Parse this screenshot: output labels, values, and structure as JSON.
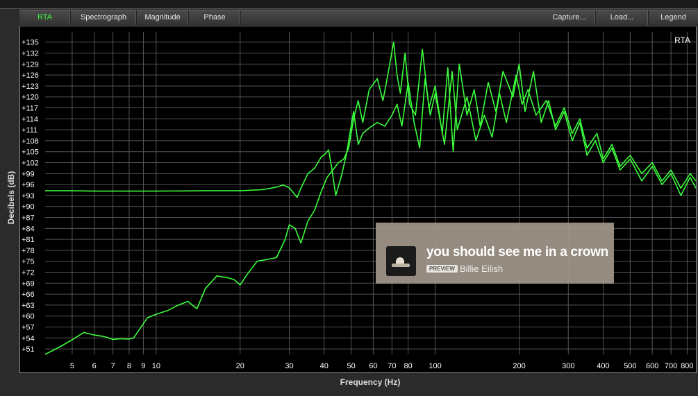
{
  "tabs": {
    "left": [
      "RTA",
      "Spectrograph",
      "Magnitude",
      "Phase"
    ],
    "right": [
      "Capture...",
      "Load...",
      "Legend"
    ],
    "active": "RTA"
  },
  "plot": {
    "title": "RTA",
    "ylabel": "Decibels (dB)",
    "xlabel": "Frequency (Hz)"
  },
  "now_playing": {
    "song": "you should see me in a crown",
    "badge": "PREVIEW",
    "artist": "Billie Eilish"
  },
  "chart_data": {
    "type": "line",
    "title": "RTA",
    "xlabel": "Frequency (Hz)",
    "ylabel": "Decibels (dB)",
    "xscale": "log",
    "xlim": [
      4,
      860
    ],
    "ylim": [
      49.5,
      137.8
    ],
    "grid": true,
    "colors": {
      "line": "#3cff3c",
      "grid": "#555555"
    },
    "x_ticks": [
      5,
      6,
      7,
      8,
      9,
      10,
      20,
      30,
      40,
      50,
      60,
      70,
      80,
      100,
      200,
      300,
      400,
      500,
      600,
      700,
      800
    ],
    "y_ticks": [
      "+51",
      "+54",
      "+57",
      "+60",
      "+63",
      "+66",
      "+69",
      "+72",
      "+75",
      "+78",
      "+81",
      "+84",
      "+87",
      "+90",
      "+93",
      "+96",
      "+99",
      "+102",
      "+105",
      "+108",
      "+111",
      "+114",
      "+117",
      "+120",
      "+123",
      "+126",
      "+129",
      "+132",
      "+135"
    ],
    "series": [
      {
        "points": [
          [
            4,
            94.3
          ],
          [
            5,
            94.3
          ],
          [
            6,
            94.2
          ],
          [
            8,
            94.2
          ],
          [
            10,
            94.2
          ],
          [
            15,
            94.3
          ],
          [
            20,
            94.3
          ],
          [
            24,
            94.6
          ],
          [
            27,
            95.3
          ],
          [
            28.5,
            95.9
          ],
          [
            30,
            95.1
          ],
          [
            31,
            93.8
          ],
          [
            32,
            92.5
          ],
          [
            33,
            95
          ],
          [
            35,
            99
          ],
          [
            37,
            100.5
          ],
          [
            39,
            103.5
          ],
          [
            40.5,
            104.5
          ],
          [
            41.5,
            105.5
          ],
          [
            42.5,
            101
          ],
          [
            44,
            93
          ],
          [
            46,
            98
          ],
          [
            48,
            104
          ],
          [
            51,
            116
          ],
          [
            53,
            107
          ],
          [
            55,
            110
          ],
          [
            58,
            111.5
          ],
          [
            62,
            113
          ],
          [
            66,
            112
          ],
          [
            70,
            115
          ],
          [
            73,
            118
          ],
          [
            76,
            112
          ],
          [
            80,
            124
          ],
          [
            84,
            113
          ],
          [
            88,
            106
          ],
          [
            92,
            125
          ],
          [
            96,
            115
          ],
          [
            100,
            121
          ],
          [
            108,
            107
          ],
          [
            115,
            127
          ],
          [
            120,
            111
          ],
          [
            130,
            120
          ],
          [
            140,
            108
          ],
          [
            150,
            115
          ],
          [
            160,
            109
          ],
          [
            170,
            121
          ],
          [
            180,
            113
          ],
          [
            195,
            126
          ],
          [
            205,
            118
          ],
          [
            215,
            122
          ],
          [
            230,
            115
          ],
          [
            250,
            119
          ],
          [
            270,
            112
          ],
          [
            290,
            117
          ],
          [
            310,
            110
          ],
          [
            330,
            114
          ],
          [
            350,
            106
          ],
          [
            380,
            110
          ],
          [
            400,
            103
          ],
          [
            430,
            107
          ],
          [
            460,
            101
          ],
          [
            500,
            104
          ],
          [
            550,
            99
          ],
          [
            600,
            102
          ],
          [
            650,
            97
          ],
          [
            700,
            100
          ],
          [
            760,
            95
          ],
          [
            820,
            99
          ],
          [
            860,
            97
          ]
        ]
      },
      {
        "points": [
          [
            4,
            49.5
          ],
          [
            4.5,
            51.5
          ],
          [
            5,
            53.5
          ],
          [
            5.5,
            55.5
          ],
          [
            6,
            54.8
          ],
          [
            6.5,
            54.4
          ],
          [
            7,
            53.6
          ],
          [
            7.5,
            53.8
          ],
          [
            8,
            53.7
          ],
          [
            8.3,
            54
          ],
          [
            9.3,
            59.5
          ],
          [
            10,
            60.5
          ],
          [
            11,
            61.5
          ],
          [
            12,
            63
          ],
          [
            13,
            64
          ],
          [
            14,
            62
          ],
          [
            15,
            67.5
          ],
          [
            16.5,
            71
          ],
          [
            18,
            70.5
          ],
          [
            19,
            70
          ],
          [
            20,
            68.5
          ],
          [
            21,
            71
          ],
          [
            23,
            75
          ],
          [
            25,
            75.5
          ],
          [
            27,
            76
          ],
          [
            29,
            81
          ],
          [
            30,
            85
          ],
          [
            31.5,
            84
          ],
          [
            33,
            80
          ],
          [
            35,
            86
          ],
          [
            37,
            89
          ],
          [
            39,
            94
          ],
          [
            41,
            98
          ],
          [
            43,
            100
          ],
          [
            45,
            102
          ],
          [
            47,
            103
          ],
          [
            49,
            106
          ],
          [
            51,
            114
          ],
          [
            53,
            119
          ],
          [
            55,
            113
          ],
          [
            58,
            122
          ],
          [
            62,
            125
          ],
          [
            65,
            119
          ],
          [
            68,
            127
          ],
          [
            71,
            135
          ],
          [
            73,
            126
          ],
          [
            75,
            121
          ],
          [
            78,
            132
          ],
          [
            81,
            118
          ],
          [
            85,
            115
          ],
          [
            90,
            133
          ],
          [
            95,
            117
          ],
          [
            100,
            123
          ],
          [
            106,
            110
          ],
          [
            111,
            128
          ],
          [
            116,
            105
          ],
          [
            122,
            129
          ],
          [
            130,
            115
          ],
          [
            138,
            122
          ],
          [
            145,
            112
          ],
          [
            155,
            124
          ],
          [
            165,
            116
          ],
          [
            175,
            127
          ],
          [
            190,
            120
          ],
          [
            200,
            129
          ],
          [
            210,
            116
          ],
          [
            225,
            127
          ],
          [
            240,
            113
          ],
          [
            255,
            119
          ],
          [
            270,
            111
          ],
          [
            290,
            116
          ],
          [
            310,
            108
          ],
          [
            330,
            113
          ],
          [
            350,
            104
          ],
          [
            375,
            108
          ],
          [
            400,
            102
          ],
          [
            430,
            106
          ],
          [
            460,
            100
          ],
          [
            500,
            103
          ],
          [
            550,
            97
          ],
          [
            600,
            101
          ],
          [
            650,
            96
          ],
          [
            700,
            99
          ],
          [
            760,
            93
          ],
          [
            820,
            98
          ],
          [
            860,
            95
          ]
        ]
      }
    ]
  }
}
